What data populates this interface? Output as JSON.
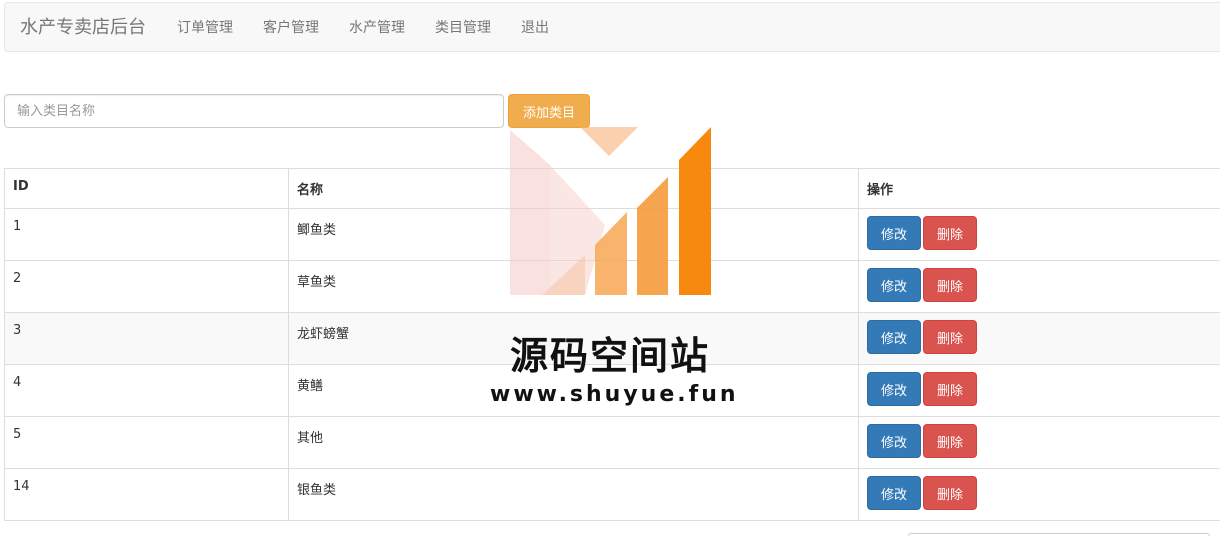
{
  "navbar": {
    "brand": "水产专卖店后台",
    "links": [
      "订单管理",
      "客户管理",
      "水产管理",
      "类目管理",
      "退出"
    ]
  },
  "search": {
    "placeholder": "输入类目名称",
    "value": ""
  },
  "add_button": "添加类目",
  "table": {
    "headers": [
      "ID",
      "名称",
      "操作"
    ],
    "rows": [
      {
        "id": "1",
        "name": "鲫鱼类"
      },
      {
        "id": "2",
        "name": "草鱼类"
      },
      {
        "id": "3",
        "name": "龙虾螃蟹"
      },
      {
        "id": "4",
        "name": "黄鳝"
      },
      {
        "id": "5",
        "name": "其他"
      },
      {
        "id": "14",
        "name": "银鱼类"
      }
    ],
    "edit_label": "修改",
    "delete_label": "删除"
  },
  "watermark": {
    "title": "源码空间站",
    "url": "www.shuyue.fun"
  },
  "colors": {
    "primary": "#337ab7",
    "danger": "#d9534f",
    "warning": "#f0ad4e",
    "navbar_bg": "#f8f8f8"
  }
}
